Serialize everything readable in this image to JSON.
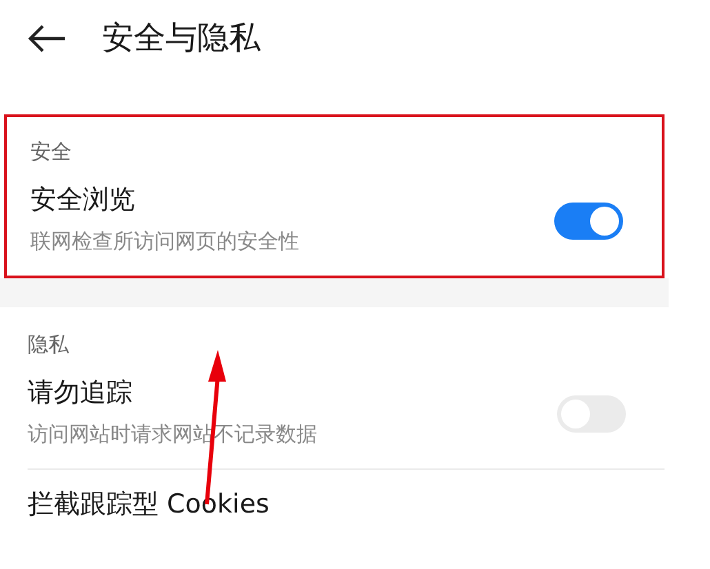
{
  "header": {
    "title": "安全与隐私"
  },
  "sections": [
    {
      "label": "安全",
      "highlighted": true,
      "items": [
        {
          "title": "安全浏览",
          "subtitle": "联网检查所访问网页的安全性",
          "on": true
        }
      ]
    },
    {
      "label": "隐私",
      "highlighted": false,
      "items": [
        {
          "title": "请勿追踪",
          "subtitle": "访问网站时请求网站不记录数据",
          "on": false
        },
        {
          "title": "拦截跟踪型 Cookies"
        }
      ]
    }
  ]
}
